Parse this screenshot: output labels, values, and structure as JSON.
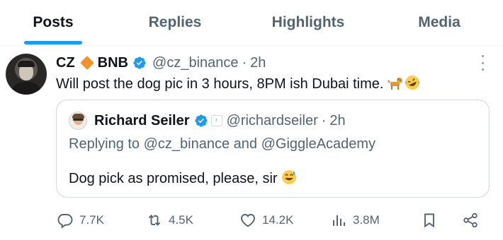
{
  "tabs": [
    {
      "label": "Posts",
      "active": true
    },
    {
      "label": "Replies",
      "active": false
    },
    {
      "label": "Highlights",
      "active": false
    },
    {
      "label": "Media",
      "active": false
    }
  ],
  "tweet": {
    "display_name": "CZ",
    "name_suffix": "BNB",
    "handle": "@cz_binance",
    "separator": "·",
    "time": "2h",
    "text": "Will post the dog pic in 3 hours, 8PM ish Dubai time. ",
    "emojis": [
      "dog-emoji",
      "rofl-emoji"
    ],
    "verified": true
  },
  "quote": {
    "display_name": "Richard Seiler",
    "handle": "@richardseiler",
    "separator": "·",
    "time": "2h",
    "replying_prefix": "Replying to ",
    "replying_to_1": "@cz_binance",
    "replying_and": " and ",
    "replying_to_2": "@GiggleAcademy",
    "text": "Dog pick as promised, please, sir ",
    "emoji": "sweat-smile-emoji",
    "verified": true
  },
  "actions": {
    "replies": "7.7K",
    "reposts": "4.5K",
    "likes": "14.2K",
    "views": "3.8M"
  },
  "colors": {
    "accent": "#1d9bf0",
    "text_primary": "#0f1419",
    "text_secondary": "#536471",
    "border": "#cfd9de",
    "brand_diamond": "#f0932b"
  }
}
